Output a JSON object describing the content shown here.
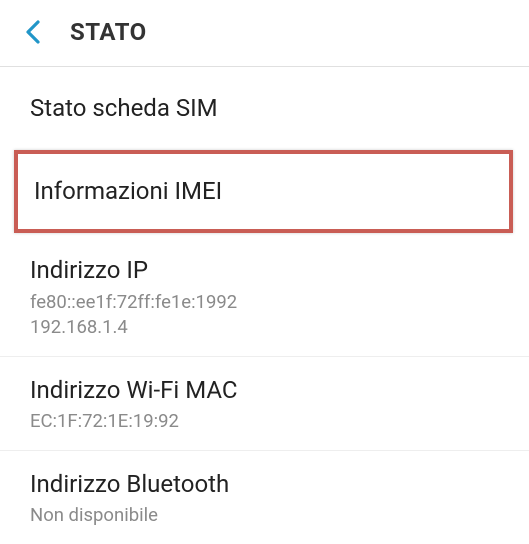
{
  "header": {
    "title": "STATO"
  },
  "items": {
    "sim": {
      "title": "Stato scheda SIM"
    },
    "imei": {
      "title": "Informazioni IMEI"
    },
    "ip": {
      "title": "Indirizzo IP",
      "line1": "fe80::ee1f:72ff:fe1e:1992",
      "line2": "192.168.1.4"
    },
    "wifi": {
      "title": "Indirizzo Wi-Fi MAC",
      "value": "EC:1F:72:1E:19:92"
    },
    "bluetooth": {
      "title": "Indirizzo Bluetooth",
      "value": "Non disponibile"
    }
  }
}
